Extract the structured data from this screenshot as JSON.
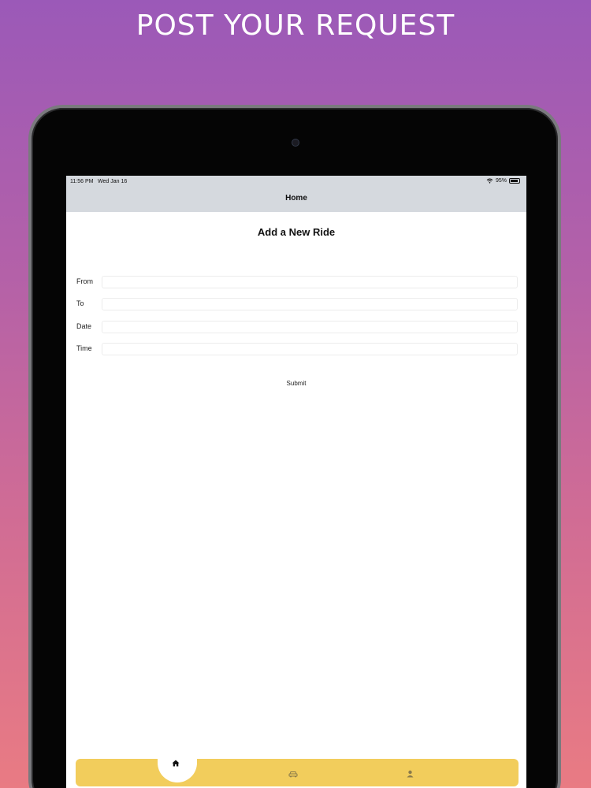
{
  "banner": {
    "title": "POST YOUR REQUEST"
  },
  "status_bar": {
    "time": "11:56 PM",
    "date": "Wed Jan 16",
    "battery": "95%"
  },
  "nav": {
    "title": "Home"
  },
  "form": {
    "title": "Add a New Ride",
    "fields": [
      {
        "label": "From",
        "value": ""
      },
      {
        "label": "To",
        "value": ""
      },
      {
        "label": "Date",
        "value": ""
      },
      {
        "label": "Time",
        "value": ""
      }
    ],
    "submit_label": "Submit"
  },
  "tab_bar": {
    "items": [
      {
        "icon": "home-icon",
        "selected": true
      },
      {
        "icon": "car-icon",
        "selected": false
      },
      {
        "icon": "profile-icon",
        "selected": false
      }
    ],
    "color": "#f2cd5c"
  }
}
